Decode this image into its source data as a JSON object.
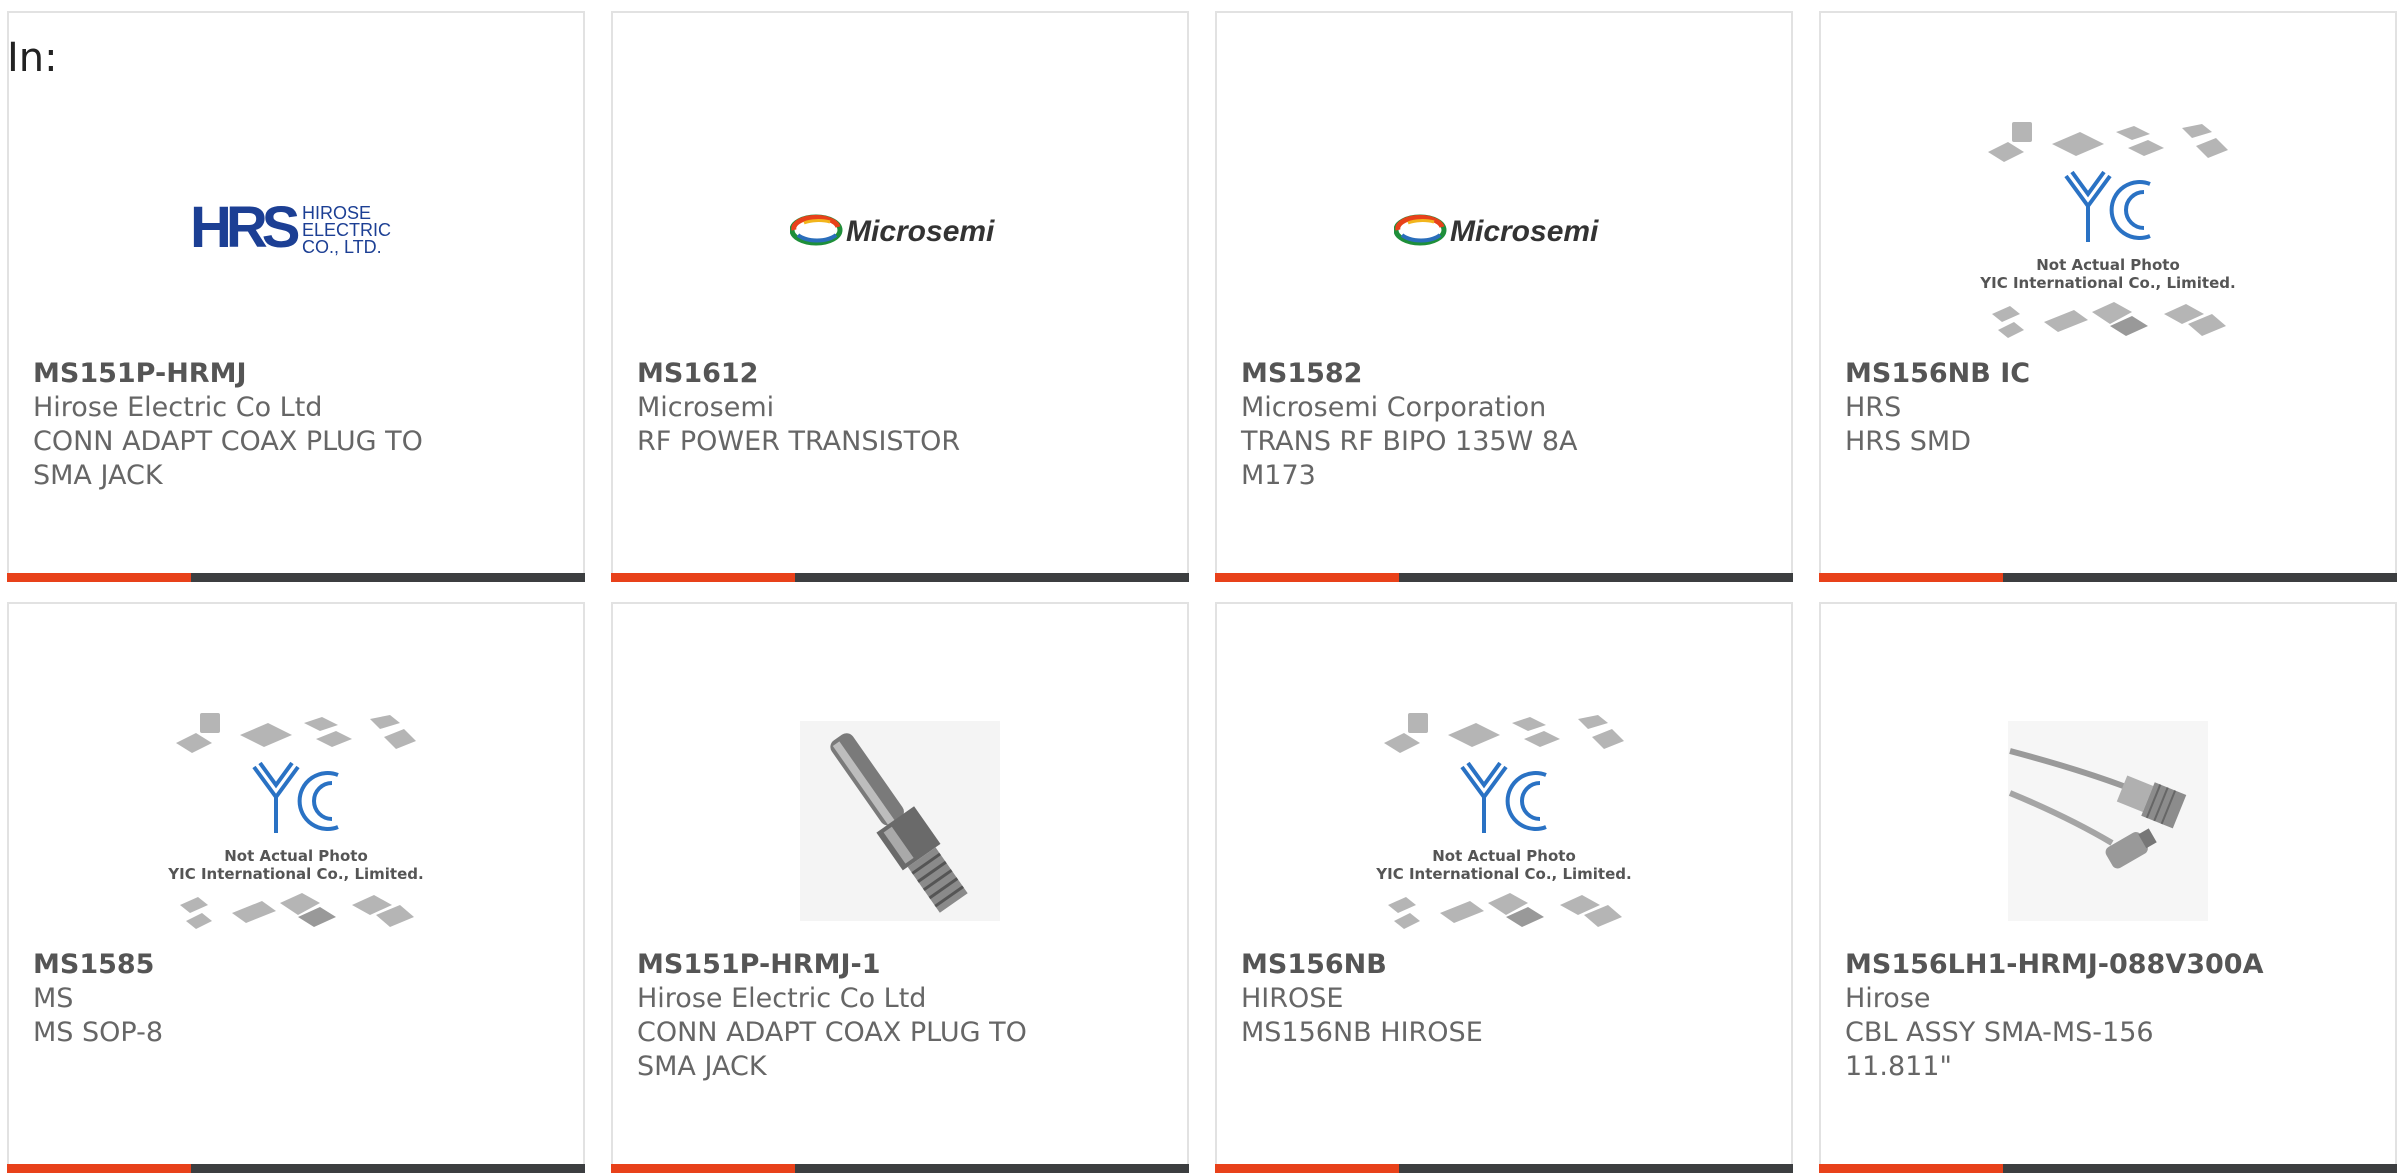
{
  "filter_label": "In:",
  "colors": {
    "accent": "#e8411a",
    "bar_dark": "#3c3e40",
    "border": "#e2e2e2",
    "text": "#666666",
    "hrs_blue": "#1c3f94"
  },
  "cards": [
    {
      "part_number": "MS151P-HRMJ",
      "manufacturer": "Hirose Electric Co Ltd",
      "description": "CONN ADAPT COAX PLUG TO SMA JACK",
      "image": "hirose-logo",
      "logo": {
        "mark": "HRS",
        "lines": [
          "HIROSE",
          "ELECTRIC",
          "CO., LTD."
        ]
      }
    },
    {
      "part_number": "MS1612",
      "manufacturer": "Microsemi",
      "description": "RF POWER TRANSISTOR",
      "image": "microsemi-logo",
      "logo": {
        "word": "Microsemi"
      }
    },
    {
      "part_number": "MS1582",
      "manufacturer": "Microsemi Corporation",
      "description": "TRANS RF BIPO 135W 8A M173",
      "image": "microsemi-logo",
      "logo": {
        "word": "Microsemi"
      }
    },
    {
      "part_number": "MS156NB IC",
      "manufacturer": "HRS",
      "description": "HRS SMD",
      "image": "yic-placeholder",
      "placeholder": {
        "mark": "YIC",
        "line1": "Not Actual Photo",
        "line2": "YIC International Co., Limited."
      }
    },
    {
      "part_number": "MS1585",
      "manufacturer": "MS",
      "description": "MS SOP-8",
      "image": "yic-placeholder",
      "placeholder": {
        "mark": "YIC",
        "line1": "Not Actual Photo",
        "line2": "YIC International Co., Limited."
      }
    },
    {
      "part_number": "MS151P-HRMJ-1",
      "manufacturer": "Hirose Electric Co Ltd",
      "description": "CONN ADAPT COAX PLUG TO SMA JACK",
      "image": "coax-adapter-photo"
    },
    {
      "part_number": "MS156NB",
      "manufacturer": "HIROSE",
      "description": "MS156NB HIROSE",
      "image": "yic-placeholder",
      "placeholder": {
        "mark": "YIC",
        "line1": "Not Actual Photo",
        "line2": "YIC International Co., Limited."
      }
    },
    {
      "part_number": "MS156LH1-HRMJ-088V300A",
      "manufacturer": "Hirose",
      "description": "CBL ASSY SMA-MS-156 11.811\"",
      "image": "cable-assembly-photo"
    }
  ]
}
